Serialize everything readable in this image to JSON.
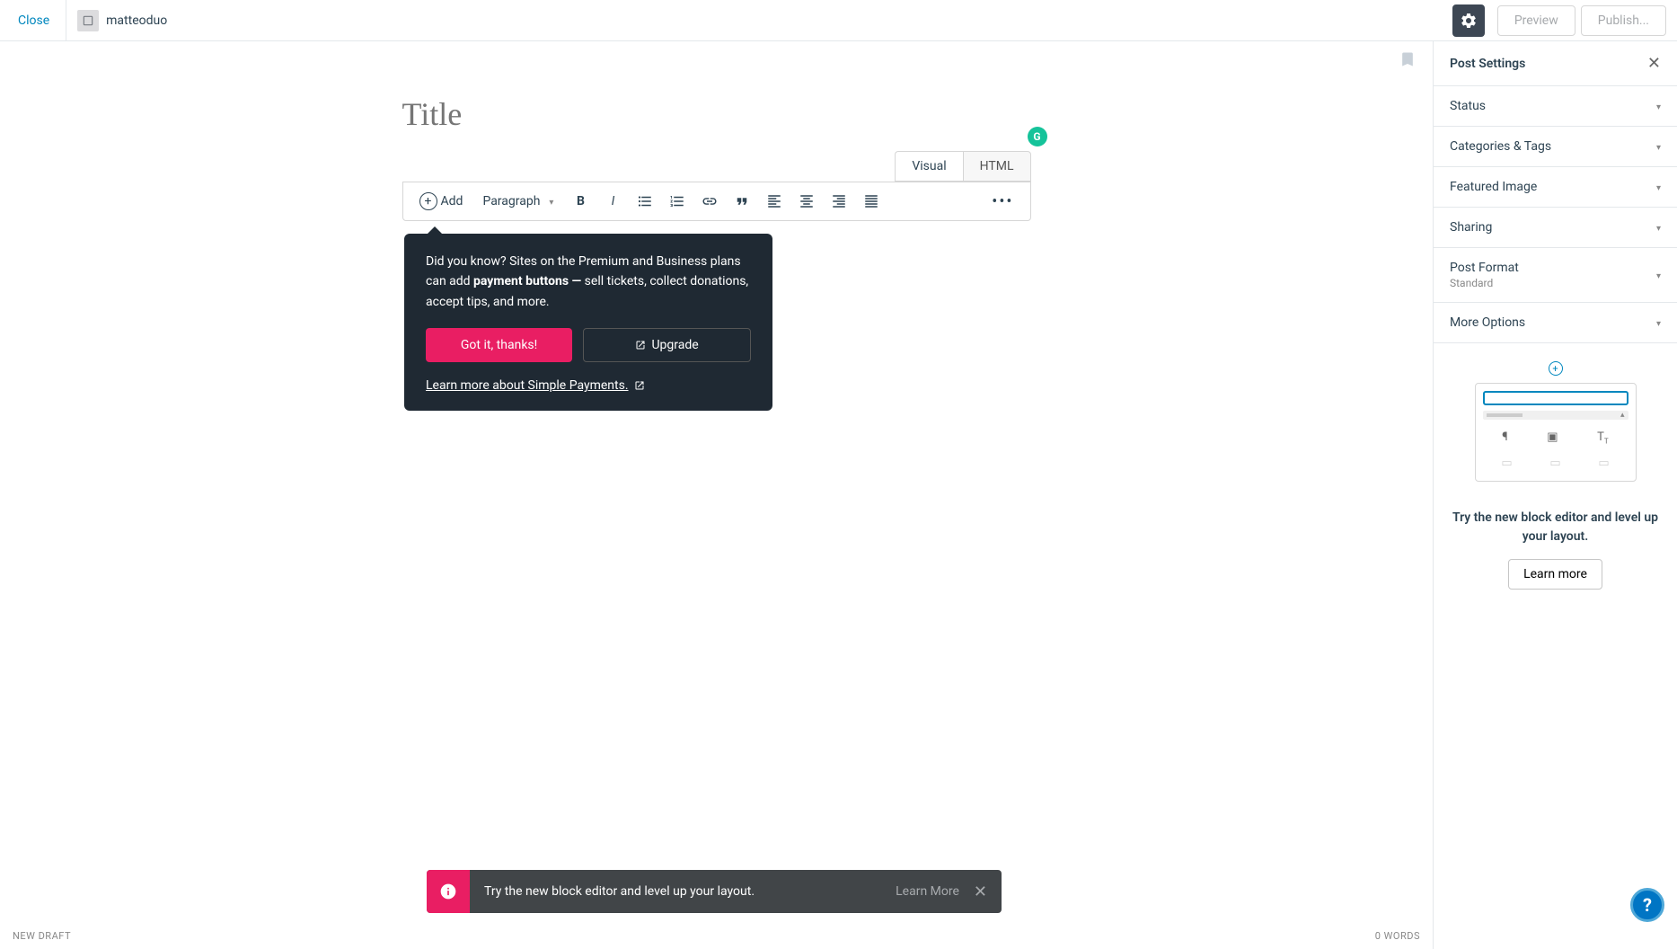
{
  "topbar": {
    "close": "Close",
    "site": "matteoduo",
    "preview": "Preview",
    "publish": "Publish..."
  },
  "editor": {
    "title_placeholder": "Title",
    "tabs": {
      "visual": "Visual",
      "html": "HTML"
    },
    "add": "Add",
    "paragraph": "Paragraph"
  },
  "tooltip": {
    "text_prefix": "Did you know? Sites on the Premium and Business plans can add ",
    "text_bold": "payment buttons —",
    "text_suffix": " sell tickets, collect donations, accept tips, and more.",
    "got_it": "Got it, thanks!",
    "upgrade": "Upgrade",
    "learn": "Learn more about Simple Payments."
  },
  "sidebar": {
    "title": "Post Settings",
    "status": "Status",
    "categories": "Categories & Tags",
    "featured": "Featured Image",
    "sharing": "Sharing",
    "post_format": "Post Format",
    "post_format_value": "Standard",
    "more_options": "More Options",
    "promo_text": "Try the new block editor and level up your layout.",
    "promo_btn": "Learn more"
  },
  "bottom": {
    "draft": "NEW DRAFT",
    "words": "0 WORDS"
  },
  "notice": {
    "text": "Try the new block editor and level up your layout.",
    "link": "Learn More"
  }
}
